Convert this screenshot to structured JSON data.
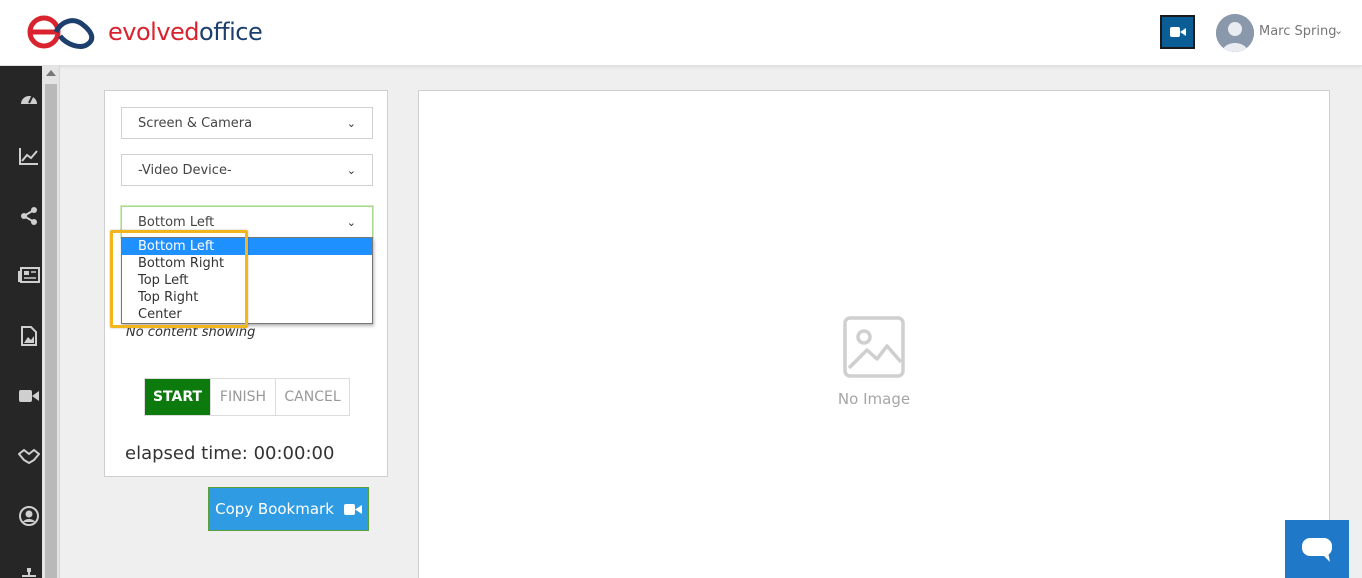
{
  "header": {
    "brand_part1": "evolved",
    "brand_part2": "office",
    "user_name": "Marc Spring",
    "camera_icon": "video-camera-icon"
  },
  "sidebar": {
    "items": [
      {
        "icon": "dashboard-icon"
      },
      {
        "icon": "chart-line-icon"
      },
      {
        "icon": "share-icon"
      },
      {
        "icon": "newspaper-icon"
      },
      {
        "icon": "image-file-icon"
      },
      {
        "icon": "video-camera-icon"
      },
      {
        "icon": "handshake-icon"
      },
      {
        "icon": "user-circle-icon"
      },
      {
        "icon": "sitemap-icon"
      }
    ]
  },
  "recorder": {
    "source_select": "Screen & Camera",
    "video_device_select": "-Video Device-",
    "position_select": "Bottom Left",
    "position_options": [
      "Bottom Left",
      "Bottom Right",
      "Top Left",
      "Top Right",
      "Center"
    ],
    "selected_option": "Bottom Left",
    "no_content": "No content showing",
    "start_label": "START",
    "finish_label": "FINISH",
    "cancel_label": "CANCEL",
    "elapsed": "elapsed time: 00:00:00",
    "copy_bookmark_label": "Copy Bookmark"
  },
  "preview": {
    "placeholder": "No Image"
  },
  "colors": {
    "brand_red": "#d9232e",
    "brand_blue": "#1d3f6e",
    "start_green": "#0d7a0d",
    "copy_blue": "#2e9be3",
    "selection_blue": "#1e90ff",
    "highlight_yellow": "#f2b51c"
  }
}
